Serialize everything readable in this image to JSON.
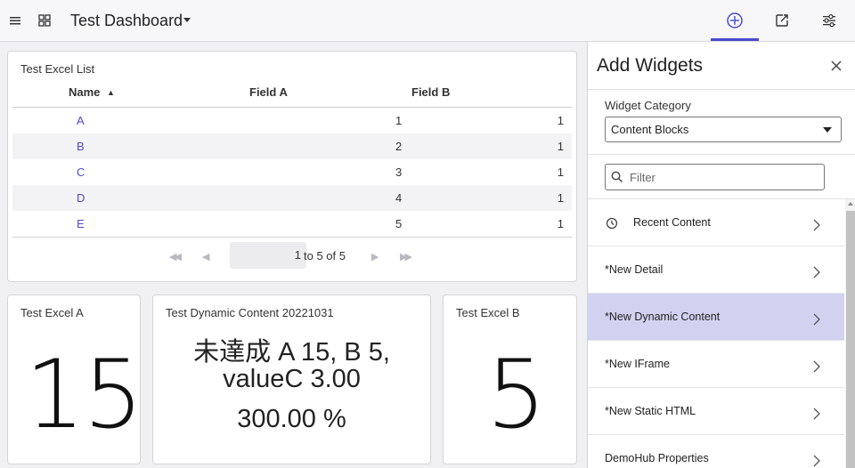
{
  "header": {
    "title": "Test Dashboard",
    "icons": [
      "menu-icon",
      "grid-icon",
      "add-circle-icon",
      "export-icon",
      "settings-sliders-icon"
    ]
  },
  "list_card": {
    "title": "Test Excel List",
    "columns": [
      "Name",
      "Field A",
      "Field B"
    ],
    "sort_indicator": "▲",
    "rows": [
      {
        "name": "A",
        "field_a": "1",
        "field_b": "1"
      },
      {
        "name": "B",
        "field_a": "2",
        "field_b": "1"
      },
      {
        "name": "C",
        "field_a": "3",
        "field_b": "1"
      },
      {
        "name": "D",
        "field_a": "4",
        "field_b": "1"
      },
      {
        "name": "E",
        "field_a": "5",
        "field_b": "1"
      }
    ],
    "pager": {
      "page": "1",
      "range_text": "to 5 of 5",
      "first_glyph": "◀◀",
      "prev_glyph": "◀",
      "next_glyph": "▶",
      "last_glyph": "▶▶"
    }
  },
  "card_a": {
    "title": "Test Excel A",
    "value": "15"
  },
  "card_dynamic": {
    "title": "Test Dynamic Content 20221031",
    "line1": "未達成 A 15, B 5,",
    "line2": "valueC 3.00",
    "line3": "300.00 %"
  },
  "card_b": {
    "title": "Test Excel B",
    "value": "5"
  },
  "panel": {
    "title": "Add Widgets",
    "category_label": "Widget Category",
    "category_value": "Content Blocks",
    "filter_placeholder": "Filter",
    "items": [
      {
        "label": "Recent Content",
        "selected": false
      },
      {
        "label": "*New Detail",
        "selected": false
      },
      {
        "label": "*New Dynamic Content",
        "selected": true
      },
      {
        "label": "*New IFrame",
        "selected": false
      },
      {
        "label": "*New Static HTML",
        "selected": false
      },
      {
        "label": "DemoHub Properties",
        "selected": false
      }
    ]
  },
  "colors": {
    "accent": "#4a4ad0",
    "selected_item": "#d2d2f0",
    "link": "#4a4ad0"
  }
}
